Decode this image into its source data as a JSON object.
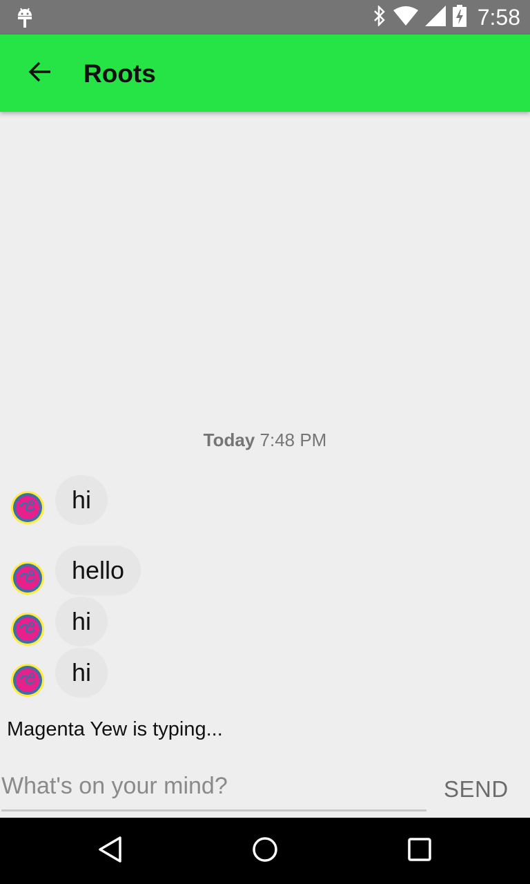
{
  "status_bar": {
    "time": "7:58",
    "icons": [
      "android-icon",
      "bluetooth-icon",
      "wifi-icon",
      "signal-icon",
      "battery-charging-icon"
    ]
  },
  "app_bar": {
    "title": "Roots",
    "back_icon": "arrow-back-icon",
    "color": "#26e346"
  },
  "conversation": {
    "date_label": "Today",
    "time_label": "7:48 PM",
    "messages": [
      {
        "text": "hi"
      },
      {
        "text": "hello"
      },
      {
        "text": "hi"
      },
      {
        "text": "hi"
      }
    ]
  },
  "typing_indicator": "Magenta Yew is typing...",
  "composer": {
    "placeholder": "What's on your mind?",
    "value": "",
    "send_label": "SEND"
  },
  "nav_bar": {
    "icons": [
      "back-triangle-icon",
      "home-circle-icon",
      "recents-square-icon"
    ]
  }
}
